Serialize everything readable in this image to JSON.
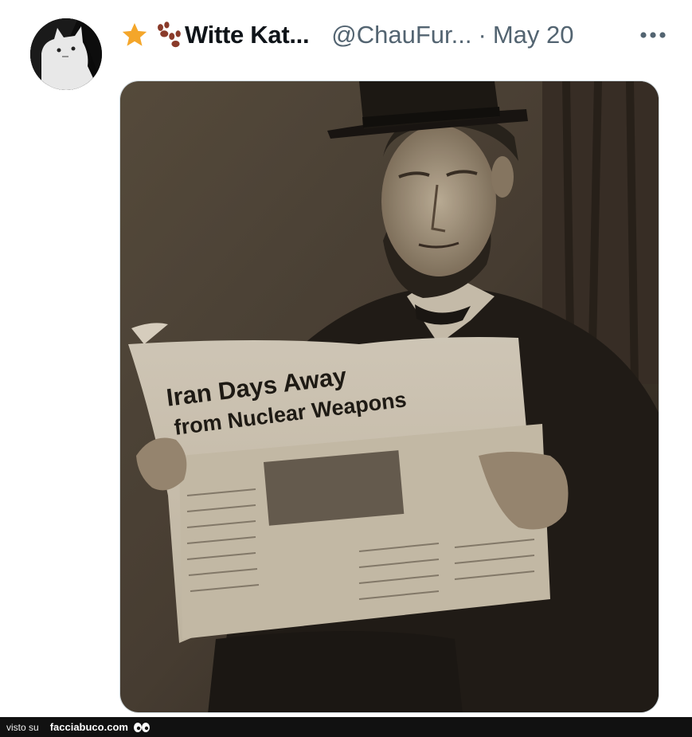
{
  "post": {
    "display_name": "Witte Kat...",
    "handle": "@ChauFur...",
    "separator": "·",
    "date": "May 20",
    "badges": [
      "star-icon",
      "paw-icon"
    ]
  },
  "image": {
    "headline_line1": "Iran Days Away",
    "headline_line2": "from Nuclear Weapons"
  },
  "watermark": {
    "prefix": "visto su",
    "site": "facciabuco.com"
  },
  "colors": {
    "name": "#0f1419",
    "secondary": "#536471",
    "star": "#f4a62a",
    "paw": "#8a3b2a"
  }
}
